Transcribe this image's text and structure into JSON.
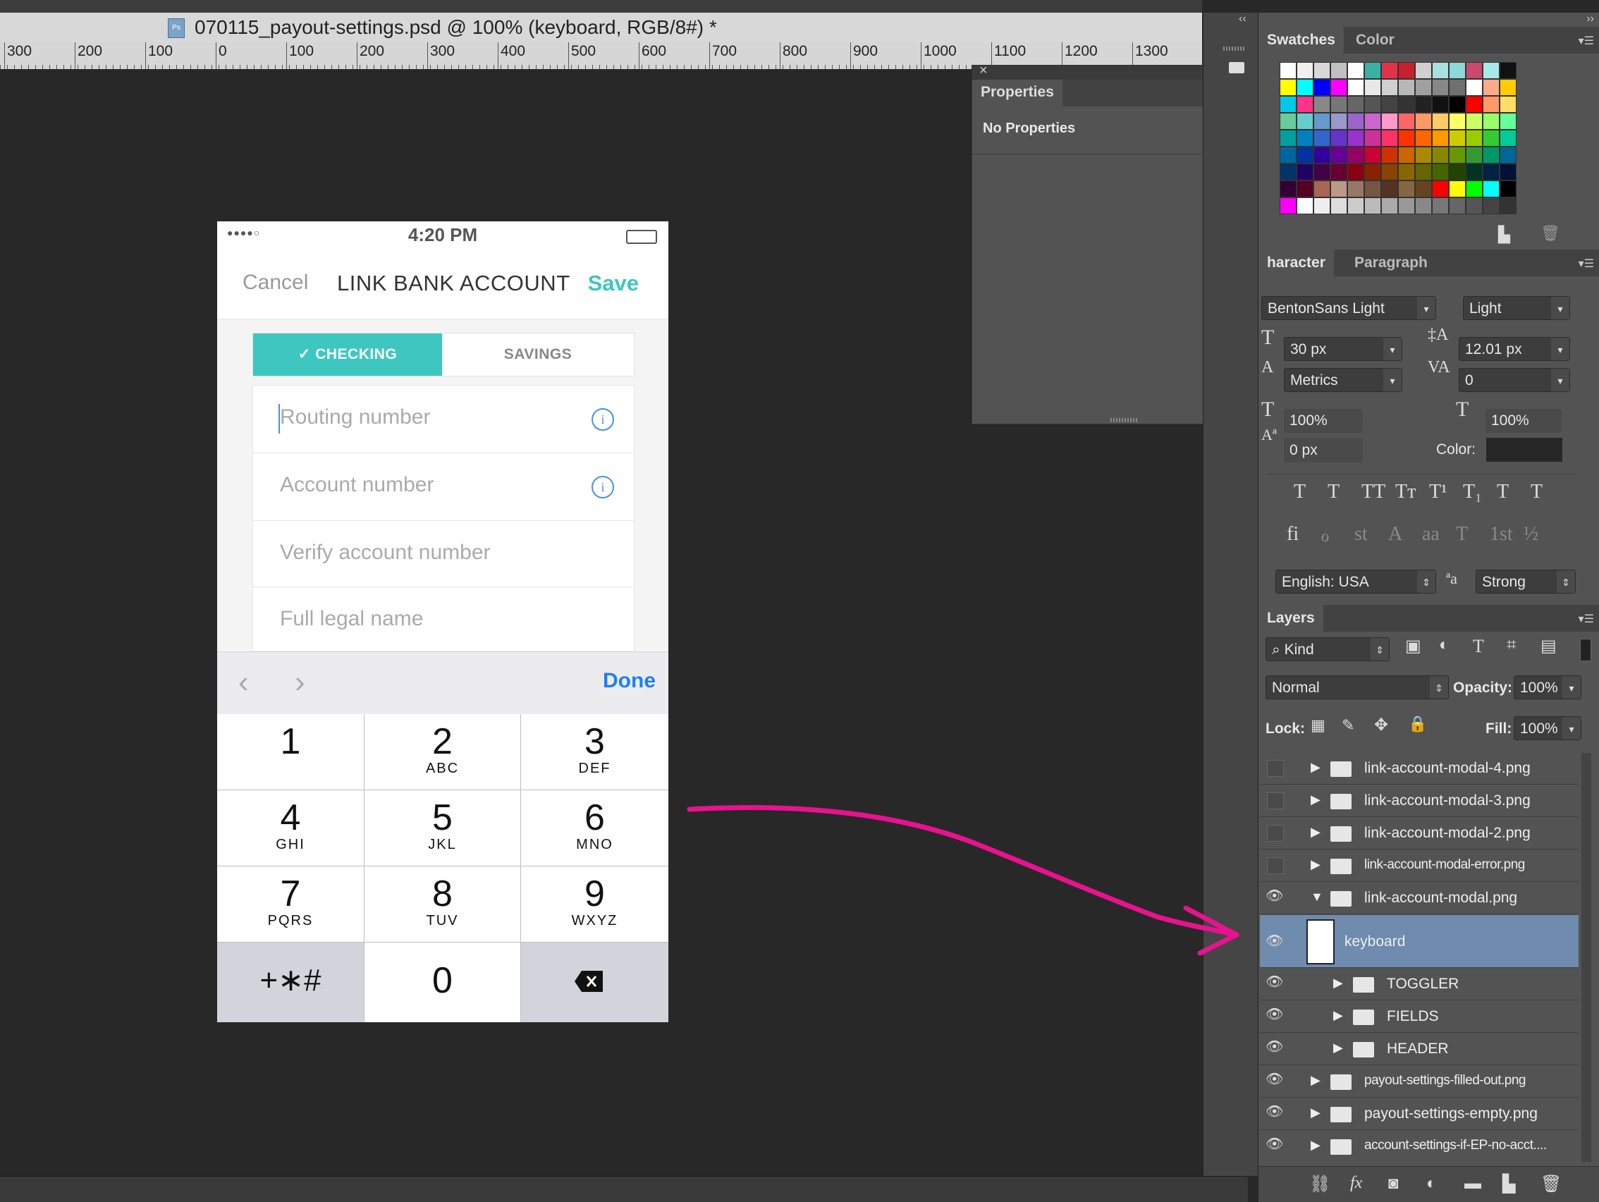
{
  "document": {
    "tab_title": "070115_payout-settings.psd @ 100% (keyboard, RGB/8#) *",
    "ruler_labels": [
      "300",
      "200",
      "100",
      "0",
      "100",
      "200",
      "300",
      "400",
      "500",
      "600",
      "700",
      "800",
      "900",
      "1000",
      "1100",
      "1200",
      "1300"
    ]
  },
  "phone": {
    "status": {
      "signal": "●●●●○",
      "time": "4:20 PM"
    },
    "nav": {
      "cancel": "Cancel",
      "title": "LINK BANK ACCOUNT",
      "save": "Save"
    },
    "toggler": {
      "active": "CHECKING",
      "inactive": "SAVINGS",
      "check_glyph": "✓"
    },
    "fields": [
      {
        "placeholder": "Routing number",
        "has_info": true
      },
      {
        "placeholder": "Account number",
        "has_info": true
      },
      {
        "placeholder": "Verify account number",
        "has_info": false
      },
      {
        "placeholder": "Full legal name",
        "has_info": false
      }
    ],
    "info_glyph": "i",
    "keyboard_bar": {
      "prev": "‹",
      "next": "›",
      "done": "Done"
    },
    "keys": [
      {
        "num": "1",
        "letters": ""
      },
      {
        "num": "2",
        "letters": "ABC"
      },
      {
        "num": "3",
        "letters": "DEF"
      },
      {
        "num": "4",
        "letters": "GHI"
      },
      {
        "num": "5",
        "letters": "JKL"
      },
      {
        "num": "6",
        "letters": "MNO"
      },
      {
        "num": "7",
        "letters": "PQRS"
      },
      {
        "num": "8",
        "letters": "TUV"
      },
      {
        "num": "9",
        "letters": "WXYZ"
      }
    ],
    "symbols_key": "+∗#",
    "zero_key": "0"
  },
  "properties_panel": {
    "tab": "Properties",
    "message": "No Properties",
    "close": "×",
    "collapse": "‹‹"
  },
  "swatches_panel": {
    "tabs": [
      "Swatches",
      "Color"
    ]
  },
  "character_panel": {
    "tabs": [
      "haracter",
      "Paragraph"
    ],
    "font_family": "BentonSans Light",
    "font_style": "Light",
    "font_size": "30 px",
    "leading": "12.01 px",
    "kerning": "Metrics",
    "tracking": "0",
    "vertical_scale": "100%",
    "horizontal_scale": "100%",
    "baseline_shift": "0 px",
    "color_label": "Color:",
    "language": "English: USA",
    "antialias": "Strong",
    "style_glyphs": [
      "T",
      "T",
      "TT",
      "Tт",
      "T¹",
      "T₁",
      "T",
      "T"
    ],
    "opentype_glyphs": [
      "fi",
      "ℴ",
      "st",
      "A",
      "aa",
      "T",
      "1st",
      "½"
    ]
  },
  "layers_panel": {
    "tab": "Layers",
    "filter": "Kind",
    "blend_mode": "Normal",
    "opacity_label": "Opacity:",
    "opacity": "100%",
    "lock_label": "Lock:",
    "fill_label": "Fill:",
    "fill": "100%",
    "layers": [
      {
        "name": "link-account-modal-4.png",
        "visible": false,
        "indent": 0,
        "type": "group"
      },
      {
        "name": "link-account-modal-3.png",
        "visible": false,
        "indent": 0,
        "type": "group"
      },
      {
        "name": "link-account-modal-2.png",
        "visible": false,
        "indent": 0,
        "type": "group"
      },
      {
        "name": "link-account-modal-error.png",
        "visible": false,
        "indent": 0,
        "type": "group"
      },
      {
        "name": "link-account-modal.png",
        "visible": true,
        "indent": 0,
        "type": "group-open"
      },
      {
        "name": "keyboard",
        "visible": true,
        "indent": 1,
        "type": "layer-selected"
      },
      {
        "name": "TOGGLER",
        "visible": true,
        "indent": 1,
        "type": "group"
      },
      {
        "name": "FIELDS",
        "visible": true,
        "indent": 1,
        "type": "group"
      },
      {
        "name": "HEADER",
        "visible": true,
        "indent": 1,
        "type": "group"
      },
      {
        "name": "payout-settings-filled-out.png",
        "visible": true,
        "indent": 0,
        "type": "group"
      },
      {
        "name": "payout-settings-empty.png",
        "visible": true,
        "indent": 0,
        "type": "group"
      },
      {
        "name": "account-settings-if-EP-no-acct....",
        "visible": true,
        "indent": 0,
        "type": "group"
      }
    ],
    "eye_glyph": "👁"
  },
  "colors": {
    "accent": "#3ec7c0",
    "done_blue": "#1f7ff0",
    "annotation": "#e8128f",
    "selected_layer": "#6f8bad"
  }
}
